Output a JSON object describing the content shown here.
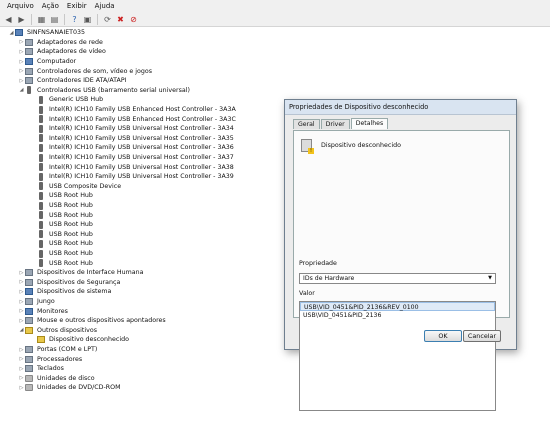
{
  "menu": [
    "Arquivo",
    "Ação",
    "Exibir",
    "Ajuda"
  ],
  "toolbar_icons": [
    "back-arrow-icon",
    "forward-arrow-icon",
    "view-icon",
    "console-icon",
    "help-icon",
    "properties-icon",
    "update-driver-icon",
    "uninstall-icon",
    "disable-icon"
  ],
  "tree": [
    {
      "label": "SINFNSANAIET035",
      "toggle": "◢",
      "icon": "pc",
      "indent": 0
    },
    {
      "label": "Adaptadores de rede",
      "toggle": "▷",
      "icon": "dev",
      "indent": 1
    },
    {
      "label": "Adaptadores de vídeo",
      "toggle": "▷",
      "icon": "dev",
      "indent": 1
    },
    {
      "label": "Computador",
      "toggle": "▷",
      "icon": "pc",
      "indent": 1
    },
    {
      "label": "Controladores de som, vídeo e jogos",
      "toggle": "▷",
      "icon": "dev",
      "indent": 1
    },
    {
      "label": "Controladores IDE ATA/ATAPI",
      "toggle": "▷",
      "icon": "dev",
      "indent": 1
    },
    {
      "label": "Controladores USB (barramento serial universal)",
      "toggle": "◢",
      "icon": "usb",
      "indent": 1
    },
    {
      "label": "Generic USB Hub",
      "toggle": "",
      "icon": "usb",
      "indent": 2
    },
    {
      "label": "Intel(R) ICH10 Family USB Enhanced Host Controller - 3A3A",
      "toggle": "",
      "icon": "usb",
      "indent": 2
    },
    {
      "label": "Intel(R) ICH10 Family USB Enhanced Host Controller - 3A3C",
      "toggle": "",
      "icon": "usb",
      "indent": 2
    },
    {
      "label": "Intel(R) ICH10 Family USB Universal Host Controller - 3A34",
      "toggle": "",
      "icon": "usb",
      "indent": 2
    },
    {
      "label": "Intel(R) ICH10 Family USB Universal Host Controller - 3A35",
      "toggle": "",
      "icon": "usb",
      "indent": 2
    },
    {
      "label": "Intel(R) ICH10 Family USB Universal Host Controller - 3A36",
      "toggle": "",
      "icon": "usb",
      "indent": 2
    },
    {
      "label": "Intel(R) ICH10 Family USB Universal Host Controller - 3A37",
      "toggle": "",
      "icon": "usb",
      "indent": 2
    },
    {
      "label": "Intel(R) ICH10 Family USB Universal Host Controller - 3A38",
      "toggle": "",
      "icon": "usb",
      "indent": 2
    },
    {
      "label": "Intel(R) ICH10 Family USB Universal Host Controller - 3A39",
      "toggle": "",
      "icon": "usb",
      "indent": 2
    },
    {
      "label": "USB Composite Device",
      "toggle": "",
      "icon": "usb",
      "indent": 2
    },
    {
      "label": "USB Root Hub",
      "toggle": "",
      "icon": "usb",
      "indent": 2
    },
    {
      "label": "USB Root Hub",
      "toggle": "",
      "icon": "usb",
      "indent": 2
    },
    {
      "label": "USB Root Hub",
      "toggle": "",
      "icon": "usb",
      "indent": 2
    },
    {
      "label": "USB Root Hub",
      "toggle": "",
      "icon": "usb",
      "indent": 2
    },
    {
      "label": "USB Root Hub",
      "toggle": "",
      "icon": "usb",
      "indent": 2
    },
    {
      "label": "USB Root Hub",
      "toggle": "",
      "icon": "usb",
      "indent": 2
    },
    {
      "label": "USB Root Hub",
      "toggle": "",
      "icon": "usb",
      "indent": 2
    },
    {
      "label": "USB Root Hub",
      "toggle": "",
      "icon": "usb",
      "indent": 2
    },
    {
      "label": "Dispositivos de Interface Humana",
      "toggle": "▷",
      "icon": "dev",
      "indent": 1
    },
    {
      "label": "Dispositivos de Segurança",
      "toggle": "▷",
      "icon": "dev",
      "indent": 1
    },
    {
      "label": "Dispositivos de sistema",
      "toggle": "▷",
      "icon": "pc",
      "indent": 1
    },
    {
      "label": "Jungo",
      "toggle": "▷",
      "icon": "dev",
      "indent": 1
    },
    {
      "label": "Monitores",
      "toggle": "▷",
      "icon": "pc",
      "indent": 1
    },
    {
      "label": "Mouse e outros dispositivos apontadores",
      "toggle": "▷",
      "icon": "dev",
      "indent": 1
    },
    {
      "label": "Outros dispositivos",
      "toggle": "◢",
      "icon": "warn",
      "indent": 1
    },
    {
      "label": "Dispositivo desconhecido",
      "toggle": "",
      "icon": "warn",
      "indent": 2
    },
    {
      "label": "Portas (COM e LPT)",
      "toggle": "▷",
      "icon": "dev",
      "indent": 1
    },
    {
      "label": "Processadores",
      "toggle": "▷",
      "icon": "dev",
      "indent": 1
    },
    {
      "label": "Teclados",
      "toggle": "▷",
      "icon": "dev",
      "indent": 1
    },
    {
      "label": "Unidades de disco",
      "toggle": "▷",
      "icon": "disk",
      "indent": 1
    },
    {
      "label": "Unidades de DVD/CD-ROM",
      "toggle": "▷",
      "icon": "disk",
      "indent": 1
    }
  ],
  "dialog": {
    "title": "Propriedades de Dispositivo desconhecido",
    "tabs": [
      "Geral",
      "Driver",
      "Detalhes"
    ],
    "active_tab": "Detalhes",
    "device_name": "Dispositivo desconhecido",
    "property_label": "Propriedade",
    "property_value": "IDs de Hardware",
    "value_label": "Valor",
    "values": [
      "USB\\VID_0451&PID_2136&REV_0100",
      "USB\\VID_0451&PID_2136"
    ],
    "ok": "OK",
    "cancel": "Cancelar"
  }
}
